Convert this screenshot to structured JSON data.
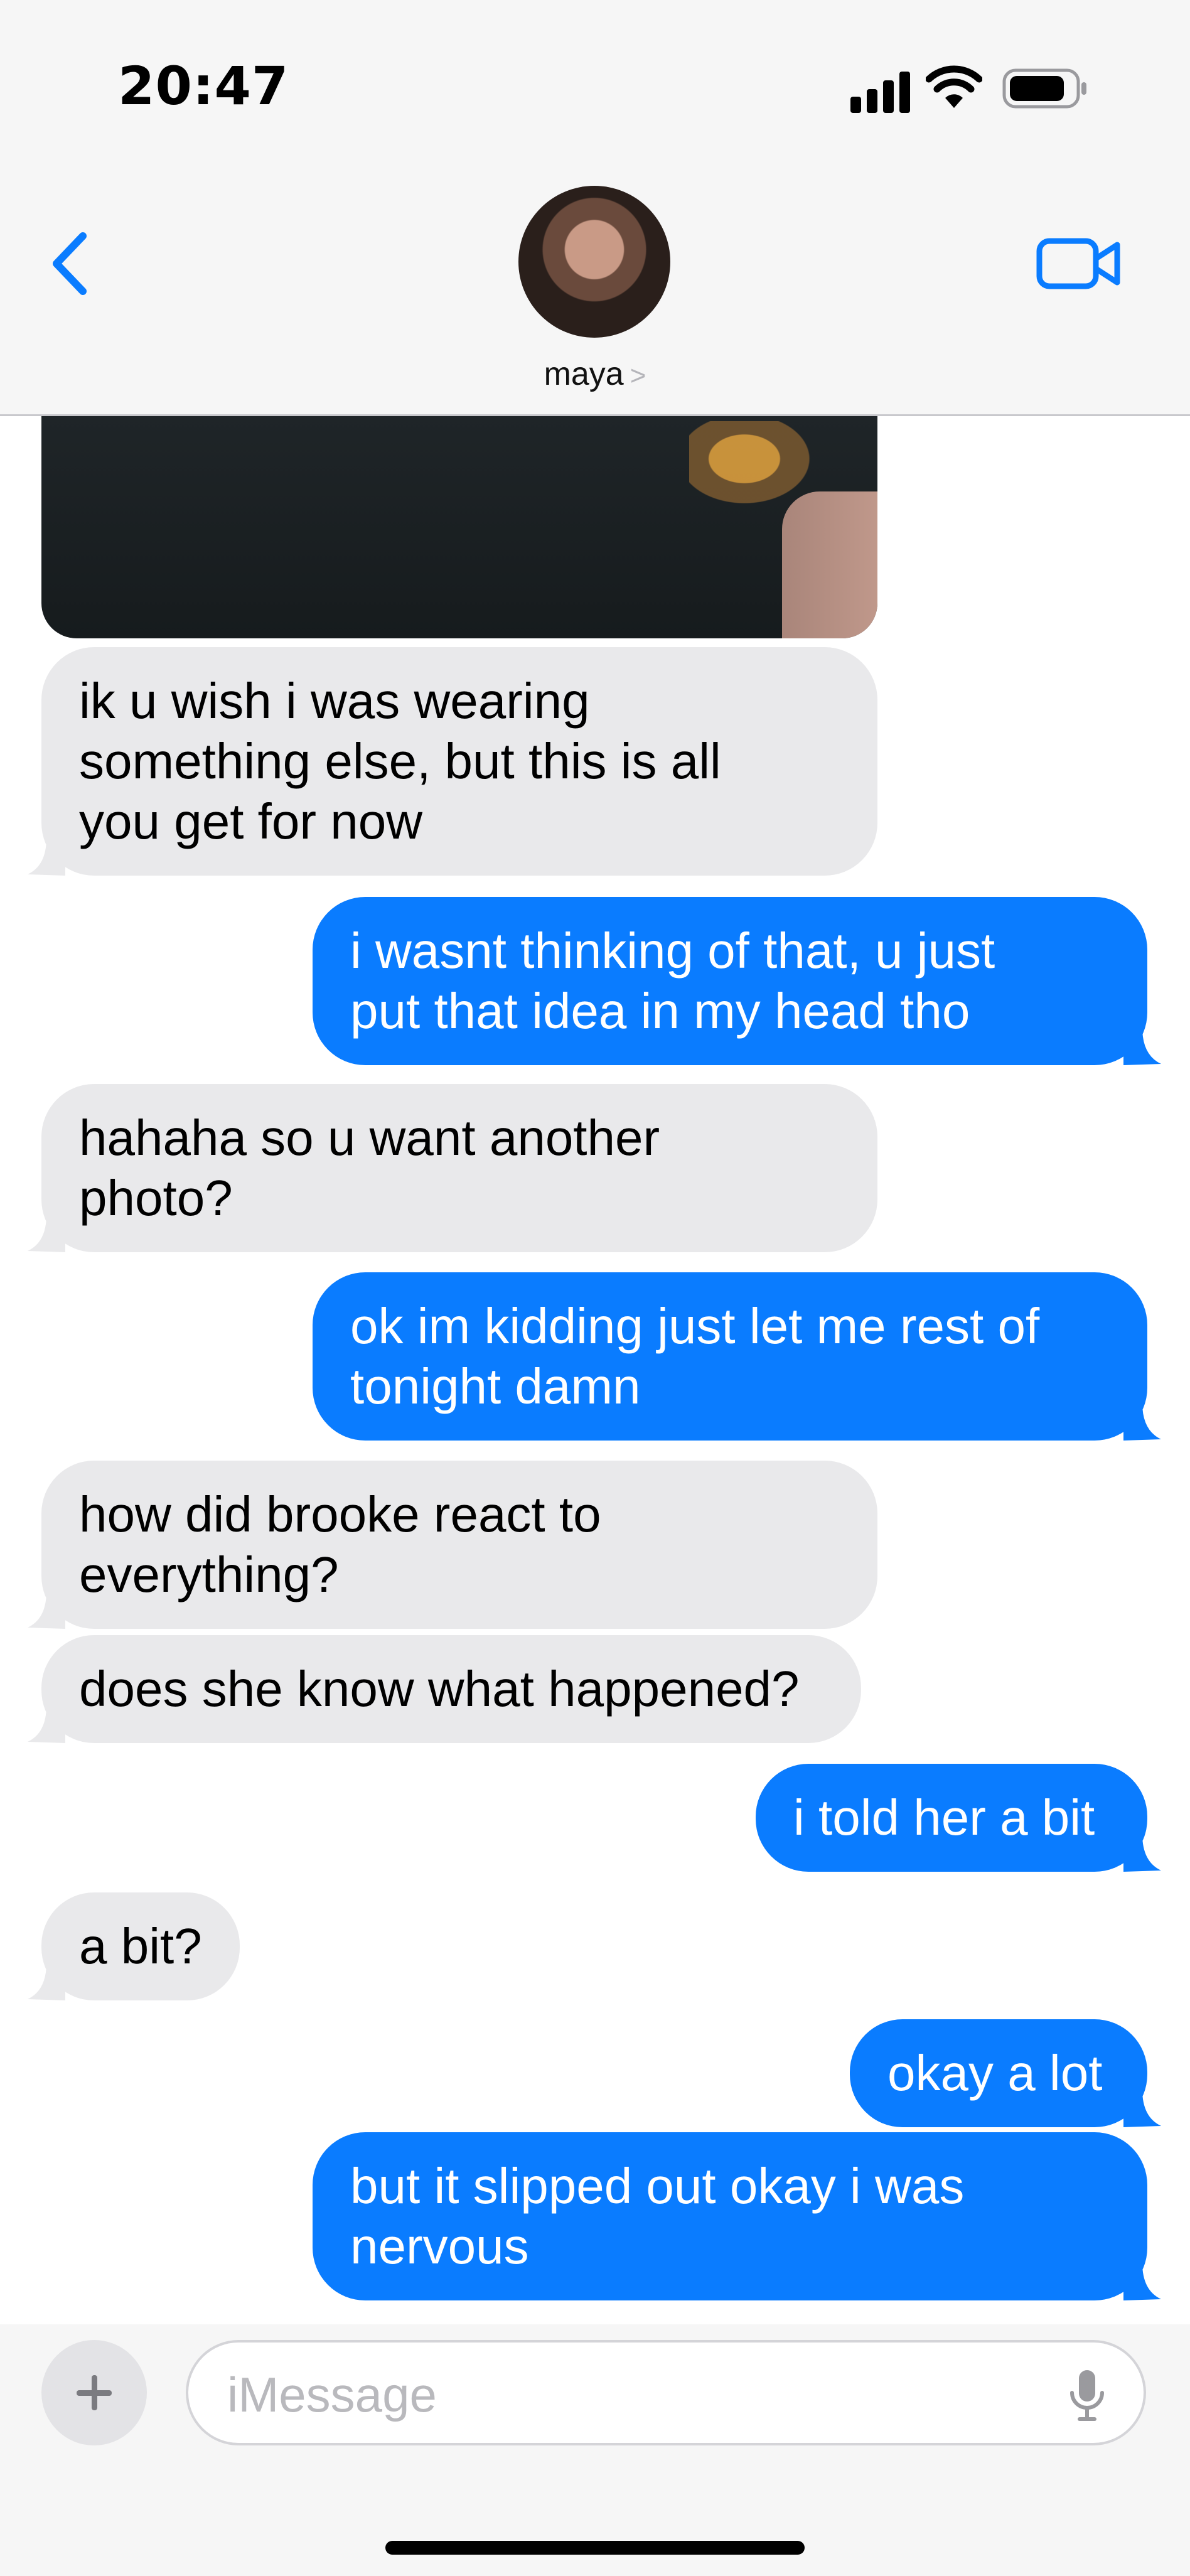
{
  "status_bar": {
    "time": "20:47"
  },
  "header": {
    "contact_name": "maya",
    "chevron": ">"
  },
  "messages": [
    {
      "dir": "in",
      "text": "ik u wish i was wearing\nsomething else, but this is all\nyou get for now"
    },
    {
      "dir": "out",
      "text": "i wasnt thinking of that, u just\nput that idea in my head tho"
    },
    {
      "dir": "in",
      "text": "hahaha so u want another\nphoto?"
    },
    {
      "dir": "out",
      "text": "ok im kidding just let me rest of\ntonight damn"
    },
    {
      "dir": "in",
      "text": "how did brooke react to\neverything?"
    },
    {
      "dir": "in",
      "text": "does she know what happened?"
    },
    {
      "dir": "out",
      "text": "i told her a bit"
    },
    {
      "dir": "in",
      "text": "a bit?"
    },
    {
      "dir": "out",
      "text": "okay a lot"
    },
    {
      "dir": "out",
      "text": "but it slipped out okay i was\nnervous"
    }
  ],
  "composer": {
    "placeholder": "iMessage"
  },
  "colors": {
    "accent": "#0a7cff",
    "incoming_bubble": "#e9e9eb"
  },
  "icons": [
    "signal-icon",
    "wifi-icon",
    "battery-icon",
    "back-chevron-icon",
    "video-call-icon",
    "plus-icon",
    "microphone-icon"
  ]
}
